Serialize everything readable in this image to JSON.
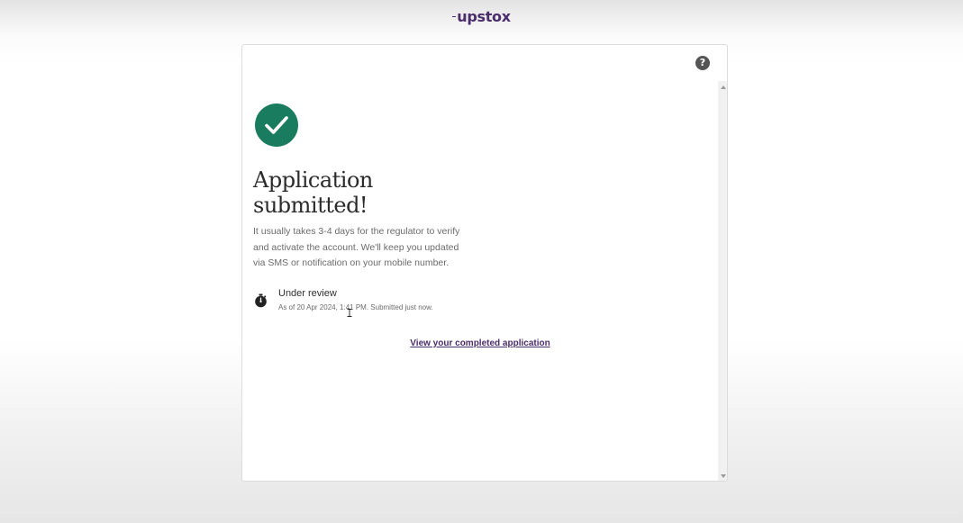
{
  "header": {
    "logo_text": "upstox",
    "brand_color": "#4a2d6b"
  },
  "card": {
    "help_icon_glyph": "?",
    "success_icon": "check-circle-icon",
    "success_color": "#1a7c5e",
    "title_line1": "Application",
    "title_line2": "submitted!",
    "description": "It usually takes 3-4 days for the regulator to verify and activate the account. We'll keep you updated via SMS or notification on your mobile number.",
    "status": {
      "icon": "stopwatch-icon",
      "label": "Under review",
      "meta": "As of 20 Apr 2024, 1:41 PM. Submitted just now."
    },
    "view_link": "View your completed application"
  }
}
